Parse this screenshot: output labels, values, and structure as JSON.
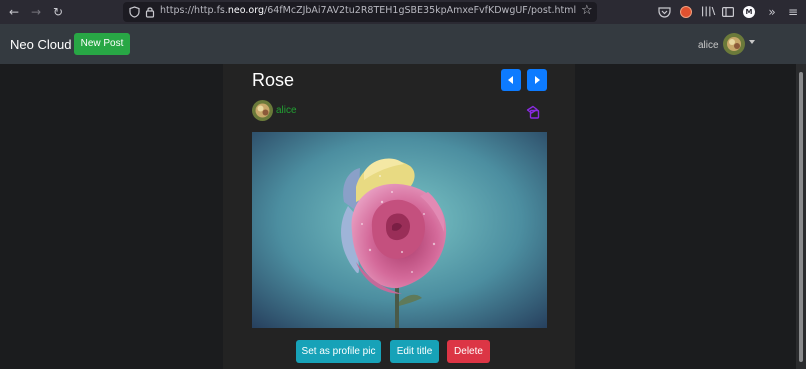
{
  "browser": {
    "url_prefix": "https://http.fs.",
    "url_domain": "neo.org",
    "url_rest": "/64fMcZJbAi7AV2tu2R8TEH1gSBE35kpAmxeFvfKDwgUF/post.html",
    "icons": [
      "back-icon",
      "forward-icon",
      "reload-icon",
      "shield-icon",
      "lock-icon",
      "star-icon",
      "pocket-icon",
      "extension-icon",
      "library-icon",
      "sidebar-icon",
      "account-icon",
      "overflow-icon",
      "menu-icon"
    ]
  },
  "navbar": {
    "brand": "Neo Cloud",
    "new_post_label": "New Post",
    "username": "alice"
  },
  "post": {
    "title": "Rose",
    "author": "alice",
    "image_alt": "Rose photo"
  },
  "actions": {
    "set_profile_label": "Set as profile pic",
    "edit_title_label": "Edit title",
    "delete_label": "Delete"
  },
  "colors": {
    "success": "#28a745",
    "primary": "#0d7bff",
    "info": "#17a2b8",
    "danger": "#dc3545",
    "author": "#22a032",
    "copy": "#8a2be2"
  }
}
